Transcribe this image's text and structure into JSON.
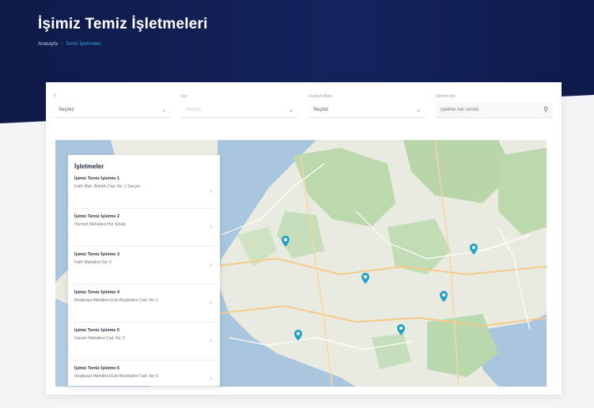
{
  "header": {
    "title": "İşimiz Temiz İşletmeleri",
    "breadcrumb": {
      "home": "Anasayfa",
      "separator": "·",
      "current": "Temiz İşletmeleri"
    }
  },
  "filters": [
    {
      "label": "İl",
      "value": "Seçiniz",
      "disabled": false
    },
    {
      "label": "İlçe",
      "value": "Seçiniz",
      "disabled": true
    },
    {
      "label": "Faaliyet Alanı",
      "value": "Seçiniz",
      "disabled": false
    }
  ],
  "search": {
    "label": "İşletme Adı",
    "placeholder": "İşletme Adı Giriniz"
  },
  "list": {
    "title": "İşletmeler",
    "items": [
      {
        "name": "İşimiz Temiz İşletme 1",
        "address": "Fatih Mah. Atatürk Cad. No: 1 Sarıyer"
      },
      {
        "name": "İşimiz Temiz İşletme 2",
        "address": "Hürriyet Mahallesi Hür Sokak"
      },
      {
        "name": "İşimiz Temiz İşletme 3",
        "address": "Fatih Mahallesi No: 6"
      },
      {
        "name": "İşimiz Temiz İşletme 4",
        "address": "Reşitpaşa Mahallesi Eski Büyükdere Cad. No: 2"
      },
      {
        "name": "İşimiz Temiz İşletme 5",
        "address": "Sarıyer Mahallesi Cad. No: 5"
      },
      {
        "name": "İşimiz Temiz İşletme 6",
        "address": "Reşitpaşa Mahallesi Eski Büyükdere Cad. No: 6"
      }
    ]
  },
  "colors": {
    "header_bg": "#13245d",
    "pin": "#1fa3c7",
    "accent": "#2fa7d8"
  }
}
